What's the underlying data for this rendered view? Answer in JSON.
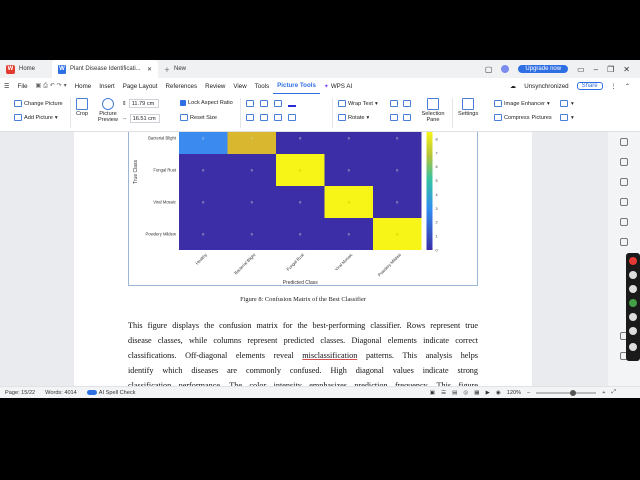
{
  "titlebar": {
    "home_tab": "Home",
    "doc_tab": "Plant Disease Identificati...",
    "new_tab": "New",
    "upgrade": "Upgrade now"
  },
  "menubar": {
    "file": "File",
    "items": [
      "Home",
      "Insert",
      "Page Layout",
      "References",
      "Review",
      "View",
      "Tools",
      "Picture Tools",
      "WPS AI"
    ],
    "sync": "Unsynchronized",
    "share": "Share"
  },
  "ribbon": {
    "change_picture": "Change Picture",
    "add_picture": "Add Picture",
    "crop": "Crop",
    "picture_preview": "Picture Preview",
    "height": "11.79 cm",
    "width": "16.51 cm",
    "lock_aspect": "Lock Aspect Ratio",
    "reset_size": "Reset Size",
    "wrap_text": "Wrap Text",
    "rotate": "Rotate",
    "selection_pane": "Selection Pane",
    "settings": "Settings",
    "image_enhancer": "Image Enhancer",
    "compress": "Compress",
    "pictures": "Pictures"
  },
  "chart_data": {
    "type": "heatmap",
    "xlabel": "Predicted Class",
    "ylabel": "True Class",
    "rows_visible": [
      "Bacterial Blight",
      "Fungal Rust",
      "Viral Mosaic",
      "Powdery Mildew"
    ],
    "columns": [
      "Healthy",
      "Bacterial Blight",
      "Fungal Rust",
      "Viral Mosaic",
      "Powdery Mildew"
    ],
    "values": [
      [
        2,
        7,
        0,
        0,
        0
      ],
      [
        0,
        0,
        9,
        0,
        0
      ],
      [
        0,
        0,
        0,
        9,
        0
      ],
      [
        0,
        0,
        0,
        0,
        9
      ]
    ],
    "colorbar_ticks": [
      0,
      1,
      2,
      3,
      4,
      5,
      6,
      7,
      8
    ],
    "colors": {
      "low": "#3b2ea6",
      "mid": "#3b8af0",
      "high_mid": "#d9b72e",
      "high": "#f7f418"
    }
  },
  "document": {
    "caption": "Figure 8: Confusion Matrix of the Best Classifier",
    "paragraph_lines": [
      "This figure displays the confusion matrix for the best-performing classifier. Rows represent true",
      "disease classes, while columns represent predicted classes. Diagonal elements indicate correct",
      "classifications. Off-diagonal elements reveal ",
      "identify which diseases are commonly confused. High diagonal values indicate strong",
      "classification performance. The color intensity emphasizes prediction frequency. This figure"
    ],
    "underlined_word": "misclassification",
    "line3_tail": " patterns. This analysis helps"
  },
  "statusbar": {
    "page": "Page: 15/22",
    "words": "Words: 4014",
    "spell": "AI Spell Check",
    "zoom": "120%"
  }
}
